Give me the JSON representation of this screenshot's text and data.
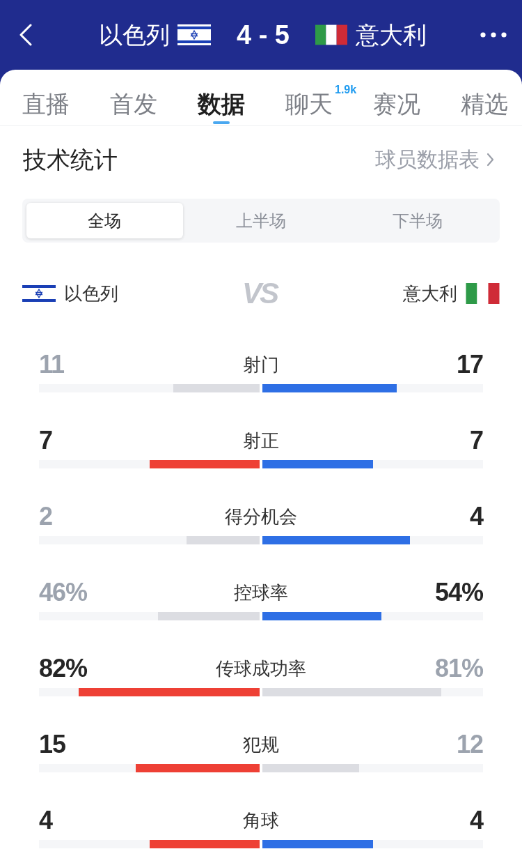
{
  "header": {
    "home_team": {
      "name": "以色列"
    },
    "score": "4 - 5",
    "away_team": {
      "name": "意大利"
    }
  },
  "tabs": [
    {
      "label": "直播",
      "selected": false
    },
    {
      "label": "首发",
      "selected": false
    },
    {
      "label": "数据",
      "selected": true
    },
    {
      "label": "聊天",
      "selected": false,
      "badge": "1.9k"
    },
    {
      "label": "赛况",
      "selected": false
    },
    {
      "label": "精选",
      "selected": false
    }
  ],
  "section": {
    "title": "技术统计",
    "link": "球员数据表"
  },
  "period_tabs": [
    {
      "label": "全场",
      "selected": true
    },
    {
      "label": "上半场",
      "selected": false
    },
    {
      "label": "下半场",
      "selected": false
    }
  ],
  "teams": {
    "home": "以色列",
    "vs": "VS",
    "away": "意大利"
  },
  "stats": [
    {
      "label": "射门",
      "home": {
        "value": "11",
        "level": 0.39,
        "highlighted": false
      },
      "away": {
        "value": "17",
        "level": 0.61,
        "highlighted": true
      }
    },
    {
      "label": "射正",
      "home": {
        "value": "7",
        "level": 0.5,
        "highlighted": true
      },
      "away": {
        "value": "7",
        "level": 0.5,
        "highlighted": true
      }
    },
    {
      "label": "得分机会",
      "home": {
        "value": "2",
        "level": 0.33,
        "highlighted": false
      },
      "away": {
        "value": "4",
        "level": 0.67,
        "highlighted": true
      }
    },
    {
      "label": "控球率",
      "home": {
        "value": "46%",
        "level": 0.46,
        "highlighted": false
      },
      "away": {
        "value": "54%",
        "level": 0.54,
        "highlighted": true
      }
    },
    {
      "label": "传球成功率",
      "home": {
        "value": "82%",
        "level": 0.82,
        "highlighted": true
      },
      "away": {
        "value": "81%",
        "level": 0.81,
        "highlighted": false
      }
    },
    {
      "label": "犯规",
      "home": {
        "value": "15",
        "level": 0.56,
        "highlighted": true
      },
      "away": {
        "value": "12",
        "level": 0.44,
        "highlighted": false
      }
    },
    {
      "label": "角球",
      "home": {
        "value": "4",
        "level": 0.5,
        "highlighted": true
      },
      "away": {
        "value": "4",
        "level": 0.5,
        "highlighted": true
      }
    }
  ]
}
